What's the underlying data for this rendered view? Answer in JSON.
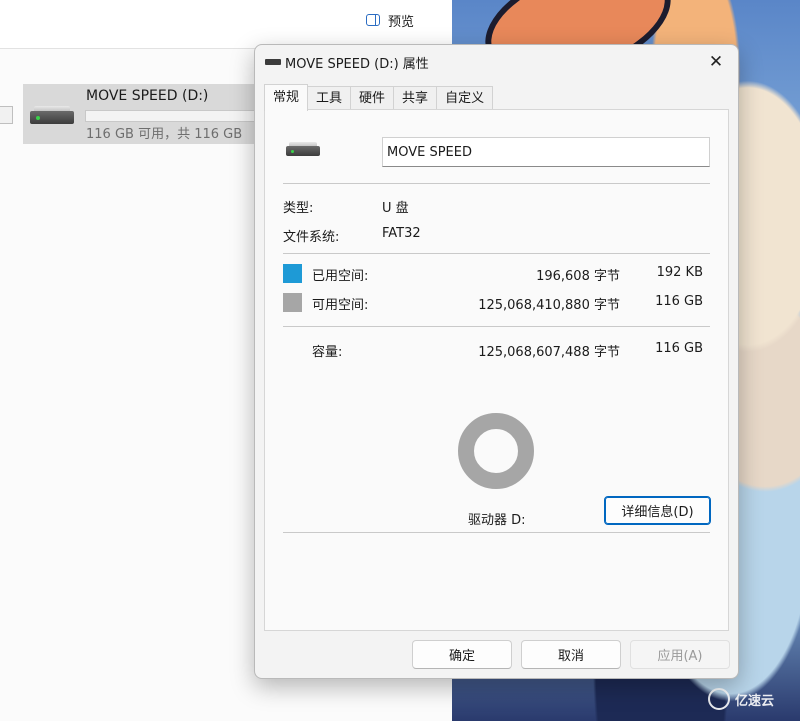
{
  "explorer": {
    "preview_label": "预览",
    "drive_name": "MOVE SPEED (D:)",
    "drive_usage": "116 GB 可用，共 116 GB"
  },
  "wallpaper": {
    "watermark_text": "亿速云"
  },
  "dialog": {
    "title": "MOVE SPEED (D:) 属性",
    "close_symbol": "✕",
    "tabs": [
      {
        "label": "常规",
        "active": true
      },
      {
        "label": "工具",
        "active": false
      },
      {
        "label": "硬件",
        "active": false
      },
      {
        "label": "共享",
        "active": false
      },
      {
        "label": "自定义",
        "active": false
      }
    ],
    "general": {
      "volume_name": "MOVE SPEED",
      "type_label": "类型:",
      "type_value": "U 盘",
      "fs_label": "文件系统:",
      "fs_value": "FAT32",
      "used_label": "已用空间:",
      "used_bytes": "196,608 字节",
      "used_size": "192 KB",
      "used_color": "#1e9ad6",
      "free_label": "可用空间:",
      "free_bytes": "125,068,410,880 字节",
      "free_size": "116 GB",
      "free_color": "#a6a6a6",
      "capacity_label": "容量:",
      "capacity_bytes": "125,068,607,488 字节",
      "capacity_size": "116 GB",
      "used_fraction": 1.6e-06,
      "drive_label": "驱动器 D:",
      "details_button": "详细信息(D)"
    },
    "buttons": {
      "ok": "确定",
      "cancel": "取消",
      "apply": "应用(A)"
    }
  }
}
